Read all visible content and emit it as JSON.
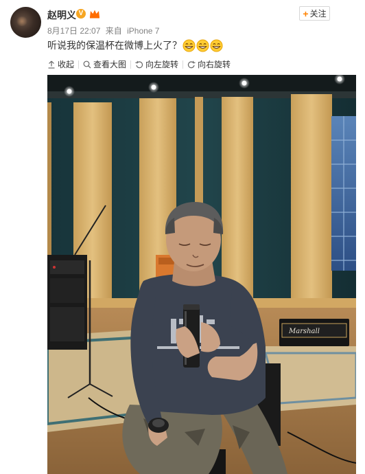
{
  "post": {
    "user_name": "赵明义",
    "verified_badge": "V",
    "follow_label": "关注",
    "date": "8月17日 22:07",
    "source_prefix": "来自",
    "device": "iPhone 7",
    "text": "听说我的保温杯在微博上火了？",
    "emoji_name": "grin-emoji",
    "emoji_count": 3
  },
  "toolbar": {
    "collapse_label": "收起",
    "view_large_label": "查看大图",
    "rotate_left_label": "向左旋转",
    "rotate_right_label": "向右旋转"
  },
  "photo": {
    "amp_brand": "Marshall"
  },
  "colors": {
    "accent": "#ff8200",
    "verified": "#f6a623",
    "meta_text": "#808080"
  }
}
